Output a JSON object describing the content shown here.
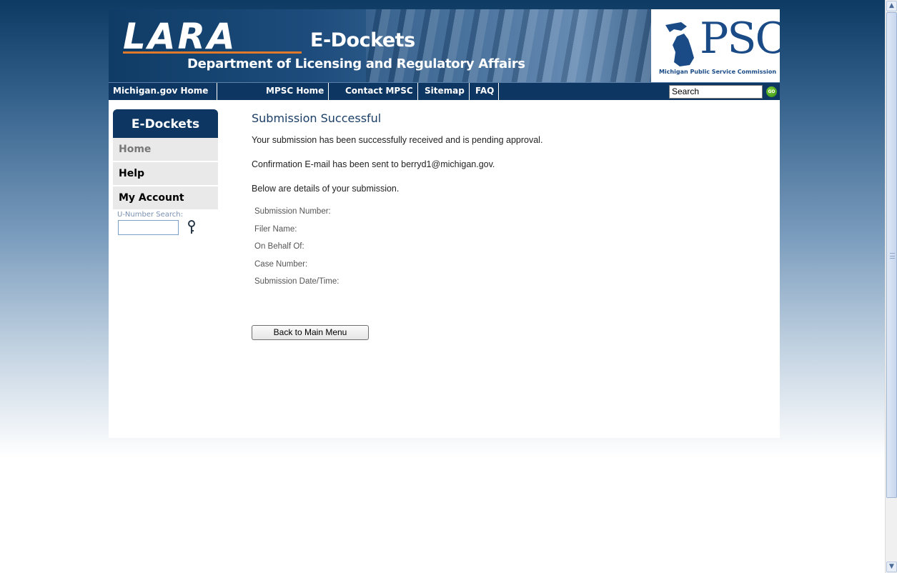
{
  "header": {
    "lara_logo": "LARA",
    "app_title": "E-Dockets",
    "department": "Department of Licensing and Regulatory Affairs",
    "psc_logo": "PSC",
    "psc_subtitle": "Michigan Public Service Commission"
  },
  "nav": {
    "items": [
      "Michigan.gov Home",
      "MPSC Home",
      "Contact MPSC",
      "Sitemap",
      "FAQ"
    ],
    "search_value": "Search",
    "go_label": "GO"
  },
  "sidebar": {
    "title": "E-Dockets",
    "items": [
      "Home",
      "Help",
      "My Account"
    ],
    "unumber_label": "U-Number Search:"
  },
  "main": {
    "title": "Submission Successful",
    "messages": [
      "Your submission has been successfully received and is pending approval.",
      "Confirmation E-mail has been sent to berryd1@michigan.gov.",
      "Below are details of your submission."
    ],
    "details": [
      "Submission Number:",
      "Filer Name:",
      "On Behalf Of:",
      "Case Number:",
      "Submission Date/Time:"
    ],
    "back_button": "Back to Main Menu"
  },
  "scrollbar": {
    "up_icon": "▲",
    "down_icon": "▼"
  }
}
